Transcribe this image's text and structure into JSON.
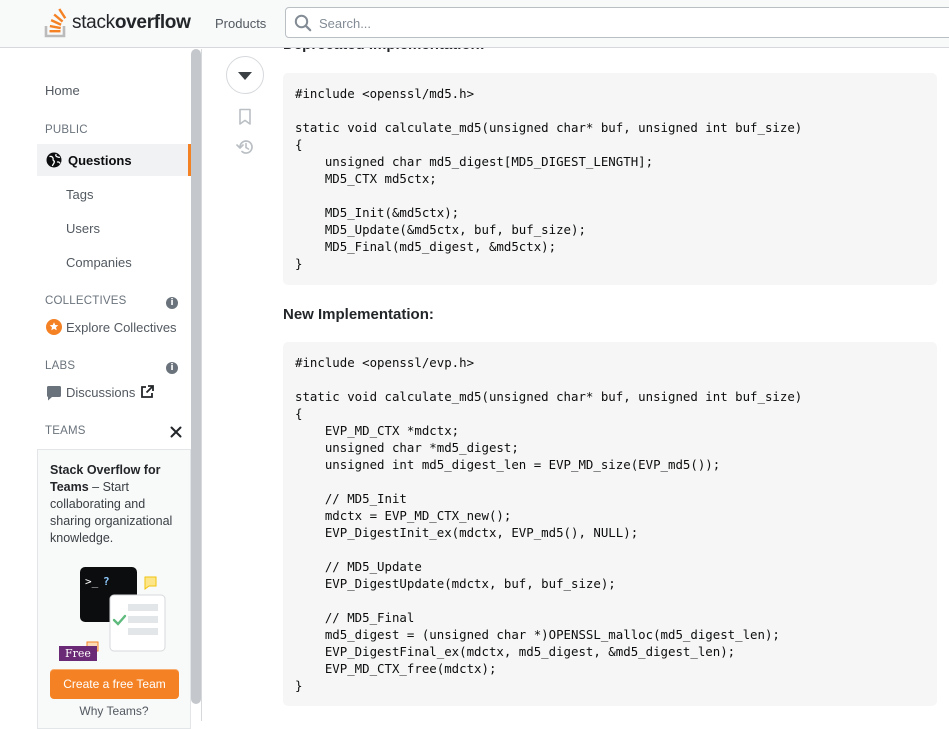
{
  "header": {
    "logo_text_light": "stack",
    "logo_text_bold": "overflow",
    "products_label": "Products",
    "search_placeholder": "Search..."
  },
  "sidebar": {
    "home": "Home",
    "public_label": "PUBLIC",
    "questions": "Questions",
    "tags": "Tags",
    "users": "Users",
    "companies": "Companies",
    "collectives_label": "COLLECTIVES",
    "explore_collectives": "Explore Collectives",
    "labs_label": "LABS",
    "discussions": "Discussions",
    "teams_label": "TEAMS",
    "teams_card": {
      "title": "Stack Overflow for Teams",
      "description": " – Start collaborating and sharing organizational knowledge.",
      "free_badge": "Free",
      "create_button": "Create a free Team",
      "why_link": "Why Teams?"
    }
  },
  "post": {
    "deprecated_heading": "Deprecated Implementation:",
    "deprecated_code": "#include <openssl/md5.h>\n\nstatic void calculate_md5(unsigned char* buf, unsigned int buf_size)\n{\n    unsigned char md5_digest[MD5_DIGEST_LENGTH];\n    MD5_CTX md5ctx;\n\n    MD5_Init(&md5ctx);\n    MD5_Update(&md5ctx, buf, buf_size);\n    MD5_Final(md5_digest, &md5ctx);\n}",
    "new_heading": "New Implementation:",
    "new_code": "#include <openssl/evp.h>\n\nstatic void calculate_md5(unsigned char* buf, unsigned int buf_size)\n{\n    EVP_MD_CTX *mdctx;\n    unsigned char *md5_digest;\n    unsigned int md5_digest_len = EVP_MD_size(EVP_md5());\n\n    // MD5_Init\n    mdctx = EVP_MD_CTX_new();\n    EVP_DigestInit_ex(mdctx, EVP_md5(), NULL);\n\n    // MD5_Update\n    EVP_DigestUpdate(mdctx, buf, buf_size);\n\n    // MD5_Final\n    md5_digest = (unsigned char *)OPENSSL_malloc(md5_digest_len);\n    EVP_DigestFinal_ex(mdctx, md5_digest, &md5_digest_len);\n    EVP_MD_CTX_free(mdctx);\n}"
  },
  "colors": {
    "accent_orange": "#f48225",
    "code_background": "#f6f6f6"
  }
}
